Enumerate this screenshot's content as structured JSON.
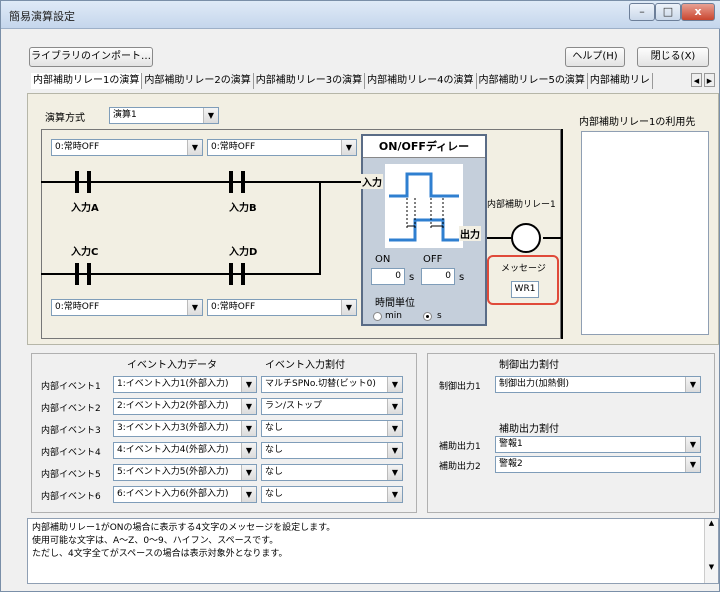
{
  "window": {
    "title": "簡易演算設定",
    "minimize": "–",
    "maximize": "□",
    "close": "x"
  },
  "toolbar": {
    "import_label": "ライブラリのインポート…",
    "help_label": "ヘルプ(H)",
    "close_label": "閉じる(X)"
  },
  "tabs": [
    "内部補助リレー1の演算",
    "内部補助リレー2の演算",
    "内部補助リレー3の演算",
    "内部補助リレー4の演算",
    "内部補助リレー5の演算",
    "内部補助リレ"
  ],
  "tab_scroll": {
    "left": "◀",
    "right": "▶"
  },
  "operation": {
    "label": "演算方式",
    "value": "演算1"
  },
  "usage_title": "内部補助リレー1の利用先",
  "inputs": {
    "a": {
      "label": "入力A",
      "select": "0:常時OFF"
    },
    "b": {
      "label": "入力B",
      "select": "0:常時OFF"
    },
    "c": {
      "label": "入力C",
      "select": "0:常時OFF"
    },
    "d": {
      "label": "入力D",
      "select": "0:常時OFF"
    }
  },
  "timer": {
    "title": "ON/OFFディレー",
    "input_label": "入力",
    "output_label": "出力",
    "on_label": "ON",
    "off_label": "OFF",
    "on_value": "0",
    "off_value": "0",
    "unit_s": "s",
    "time_unit_label": "時間単位",
    "min_label": "min",
    "s_label": "s",
    "selected_unit": "s"
  },
  "relay": {
    "label": "内部補助リレー1",
    "message_label": "メッセージ",
    "message_value": "WR1"
  },
  "events": {
    "header_data": "イベント入力データ",
    "header_assign": "イベント入力割付",
    "rows": [
      {
        "name": "内部イベント1",
        "data": "1:イベント入力1(外部入力)",
        "assign": "マルチSPNo.切替(ビット0)"
      },
      {
        "name": "内部イベント2",
        "data": "2:イベント入力2(外部入力)",
        "assign": "ラン/ストップ"
      },
      {
        "name": "内部イベント3",
        "data": "3:イベント入力3(外部入力)",
        "assign": "なし"
      },
      {
        "name": "内部イベント4",
        "data": "4:イベント入力4(外部入力)",
        "assign": "なし"
      },
      {
        "name": "内部イベント5",
        "data": "5:イベント入力5(外部入力)",
        "assign": "なし"
      },
      {
        "name": "内部イベント6",
        "data": "6:イベント入力6(外部入力)",
        "assign": "なし"
      }
    ]
  },
  "control": {
    "header": "制御出力割付",
    "row_label": "制御出力1",
    "row_value": "制御出力(加熱側)",
    "aux_header": "補助出力割付",
    "aux_rows": [
      {
        "label": "補助出力1",
        "value": "警報1"
      },
      {
        "label": "補助出力2",
        "value": "警報2"
      }
    ]
  },
  "status": {
    "lines": [
      "内部補助リレー1がONの場合に表示する4文字のメッセージを設定します。",
      "使用可能な文字は、A〜Z、0〜9、ハイフン、スペースです。",
      "ただし、4文字全てがスペースの場合は表示対象外となります。"
    ]
  },
  "icons": {
    "dropdown": "chevron-down-icon",
    "scroll_up": "▲",
    "scroll_down": "▼",
    "arrow": "▼"
  },
  "colors": {
    "message_border": "#e04a3a",
    "timer_bg": "#c5cfdb",
    "panel_bg": "#f2efe3",
    "wave": "#2f7fd0"
  }
}
